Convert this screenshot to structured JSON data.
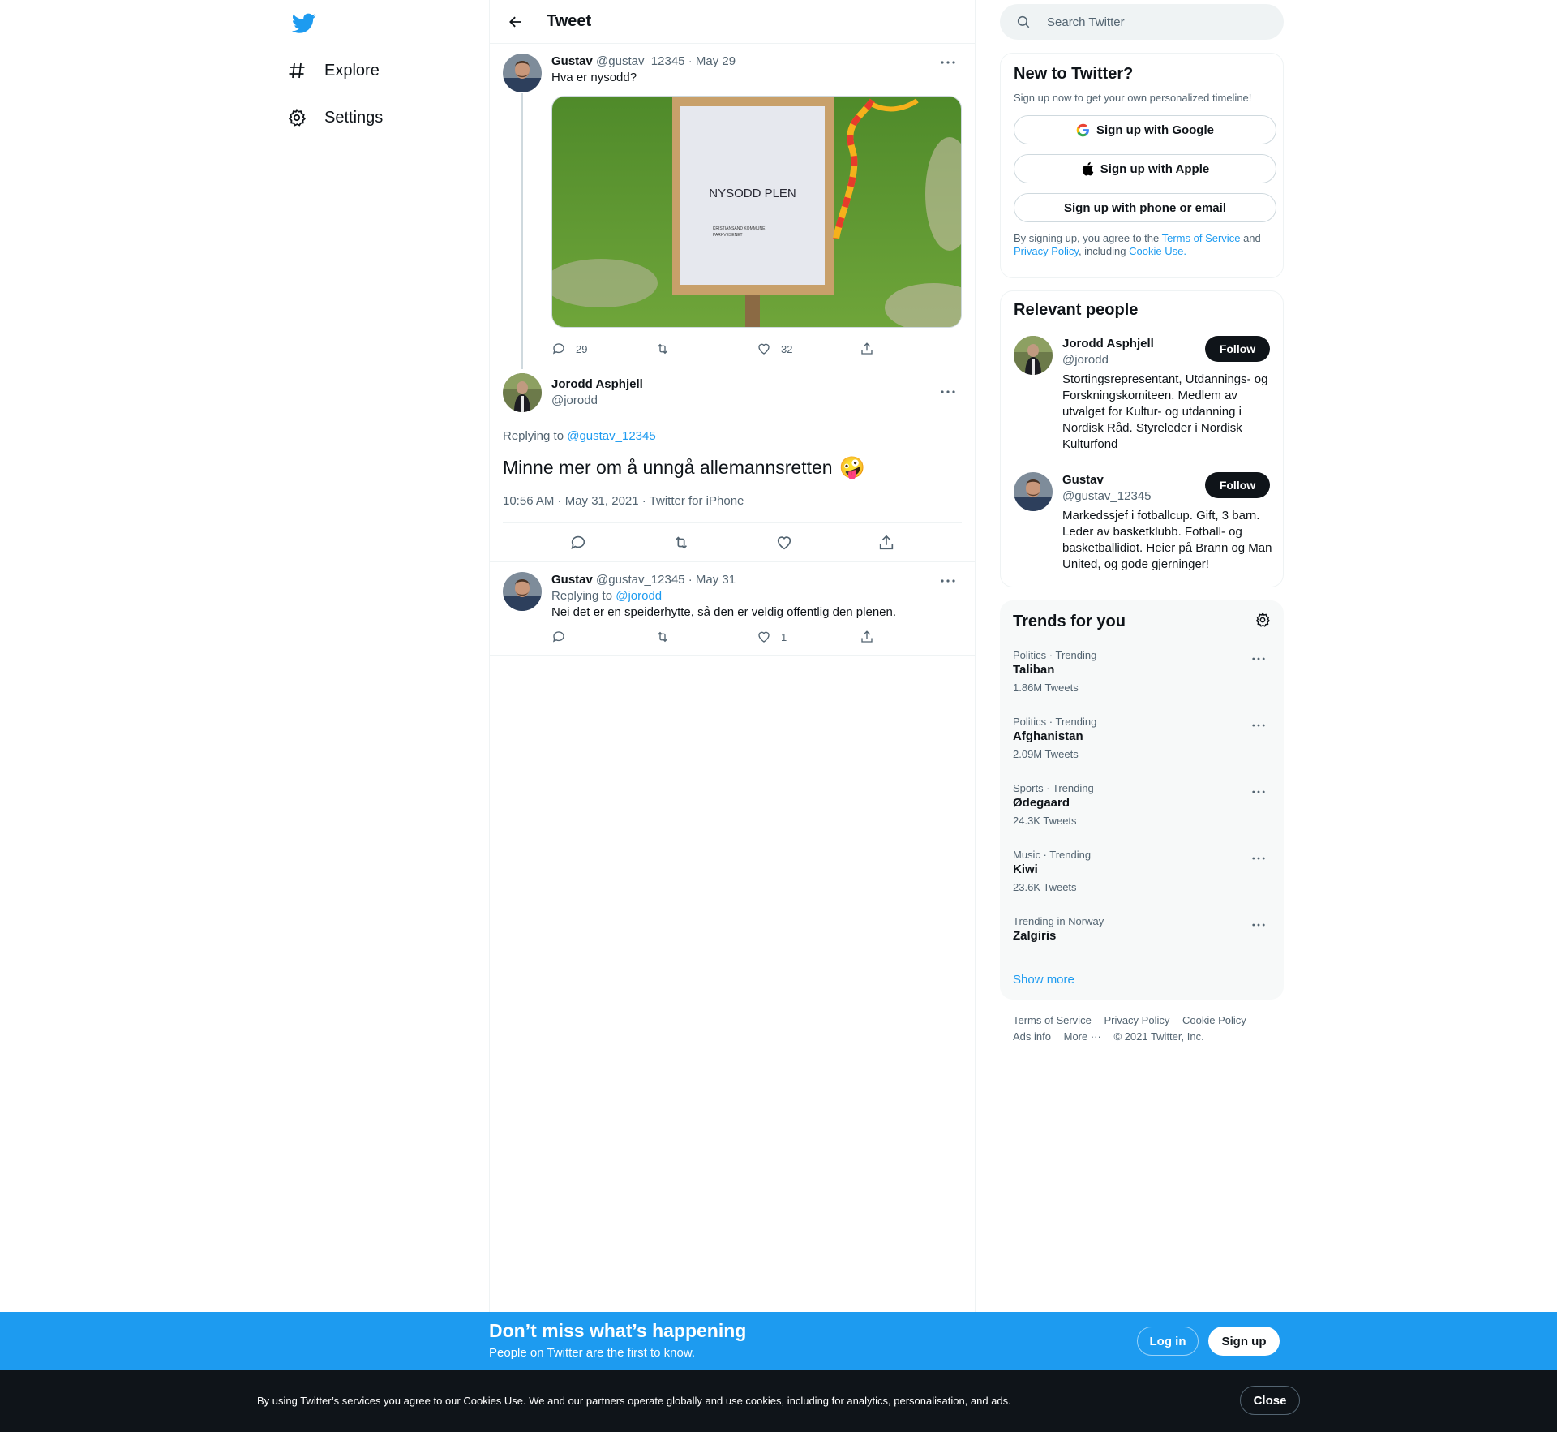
{
  "nav": {
    "items": [
      {
        "label": "Explore",
        "icon": "hashtag-icon"
      },
      {
        "label": "Settings",
        "icon": "gear-icon"
      }
    ]
  },
  "header": {
    "title": "Tweet"
  },
  "thread": {
    "first": {
      "name": "Gustav",
      "handle": "@gustav_12345",
      "date": "· May 29",
      "text": "Hva er nysodd?",
      "image_sign_text": "NYSODD PLEN",
      "image_small_text_1": "KRISTIANSAND KOMMUNE",
      "image_small_text_2": "PARKVESENET",
      "replies": "29",
      "retweets": "",
      "likes": "32"
    },
    "focal": {
      "name": "Jorodd Asphjell",
      "handle": "@jorodd",
      "replying_prefix": "Replying to",
      "replying_to": "@gustav_12345",
      "text": "Minne mer om å unngå allemannsretten",
      "emoji": "🤪",
      "meta": "10:56 AM · May 31, 2021 · Twitter for iPhone"
    },
    "reply": {
      "name": "Gustav",
      "handle": "@gustav_12345",
      "date": "· May 31",
      "replying_prefix": "Replying to",
      "replying_to": "@jorodd",
      "text": "Nei det er en speiderhytte, så den er veldig offentlig den plenen.",
      "replies": "",
      "retweets": "",
      "likes": "1"
    }
  },
  "search": {
    "placeholder": "Search Twitter"
  },
  "signup": {
    "title": "New to Twitter?",
    "subtitle": "Sign up now to get your own personalized timeline!",
    "google": "Sign up with Google",
    "apple": "Sign up with Apple",
    "phone": "Sign up with phone or email",
    "legal_1": "By signing up, you agree to the",
    "tos": "Terms of Service",
    "legal_2": "and",
    "privacy": "Privacy Policy",
    "legal_3": ", including",
    "cookie": "Cookie Use."
  },
  "people": {
    "title": "Relevant people",
    "follow_label": "Follow",
    "list": [
      {
        "name": "Jorodd Asphjell",
        "handle": "@jorodd",
        "bio": "Stortingsrepresentant, Utdannings- og Forskningskomiteen. Medlem av utvalget for Kultur- og utdanning i Nordisk Råd. Styreleder i Nordisk Kulturfond"
      },
      {
        "name": "Gustav",
        "handle": "@gustav_12345",
        "bio": "Markedssjef i fotballcup. Gift, 3 barn. Leder av basketklubb. Fotball- og basketballidiot. Heier på Brann og Man United, og gode gjerninger!"
      }
    ]
  },
  "trends": {
    "title": "Trends for you",
    "items": [
      {
        "category": "Politics · Trending",
        "name": "Taliban",
        "count": "1.86M Tweets"
      },
      {
        "category": "Politics · Trending",
        "name": "Afghanistan",
        "count": "2.09M Tweets"
      },
      {
        "category": "Sports · Trending",
        "name": "Ødegaard",
        "count": "24.3K Tweets"
      },
      {
        "category": "Music · Trending",
        "name": "Kiwi",
        "count": "23.6K Tweets"
      },
      {
        "category": "Trending in Norway",
        "name": "Zalgiris",
        "count": ""
      }
    ],
    "show_more": "Show more"
  },
  "footer": {
    "links": [
      "Terms of Service",
      "Privacy Policy",
      "Cookie Policy",
      "Ads info",
      "More ···",
      "© 2021 Twitter, Inc."
    ]
  },
  "banner": {
    "title": "Don’t miss what’s happening",
    "subtitle": "People on Twitter are the first to know.",
    "login": "Log in",
    "signup": "Sign up"
  },
  "cookie_bar": {
    "text": "By using Twitter’s services you agree to our Cookies Use. We and our partners operate globally and use cookies, including for analytics, personalisation, and ads.",
    "close": "Close"
  },
  "colors": {
    "accent": "#1d9bf0",
    "text": "#0f1419",
    "secondary": "#536471",
    "border": "#eff3f4"
  }
}
